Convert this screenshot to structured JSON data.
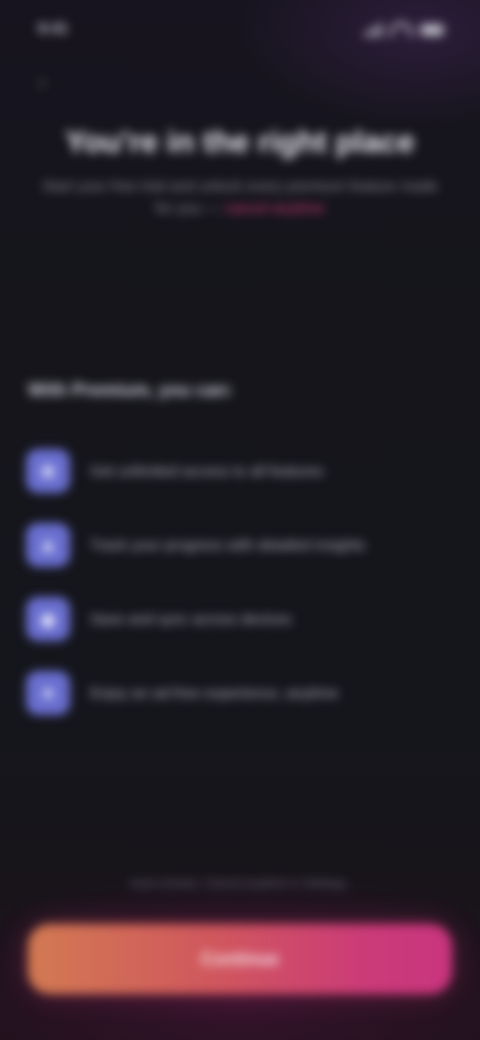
{
  "status_bar": {
    "time": "9:41"
  },
  "header": {
    "back_icon": "chevron-left-icon",
    "title": "You're in the right place",
    "subtitle_lead": "Start your free trial and unlock every premium feature made for you —",
    "subtitle_accent": "cancel anytime"
  },
  "features": {
    "heading": "With Premium, you can:",
    "items": [
      {
        "icon": "star-icon",
        "glyph": "★",
        "label": "Get unlimited access to all features"
      },
      {
        "icon": "chart-icon",
        "glyph": "▲",
        "label": "Track your progress with detailed insights"
      },
      {
        "icon": "lock-icon",
        "glyph": "◆",
        "label": "Save and sync across devices"
      },
      {
        "icon": "bolt-icon",
        "glyph": "●",
        "label": "Enjoy an ad-free experience, anytime"
      }
    ]
  },
  "footer": {
    "terms": "Auto-renews. Cancel anytime in Settings.",
    "cta_label": "Continue"
  },
  "colors": {
    "background": "#15151d",
    "feature_icon_bg": "#6a6fd0",
    "cta_gradient_start": "#d27a52",
    "cta_gradient_end": "#c9357e"
  }
}
